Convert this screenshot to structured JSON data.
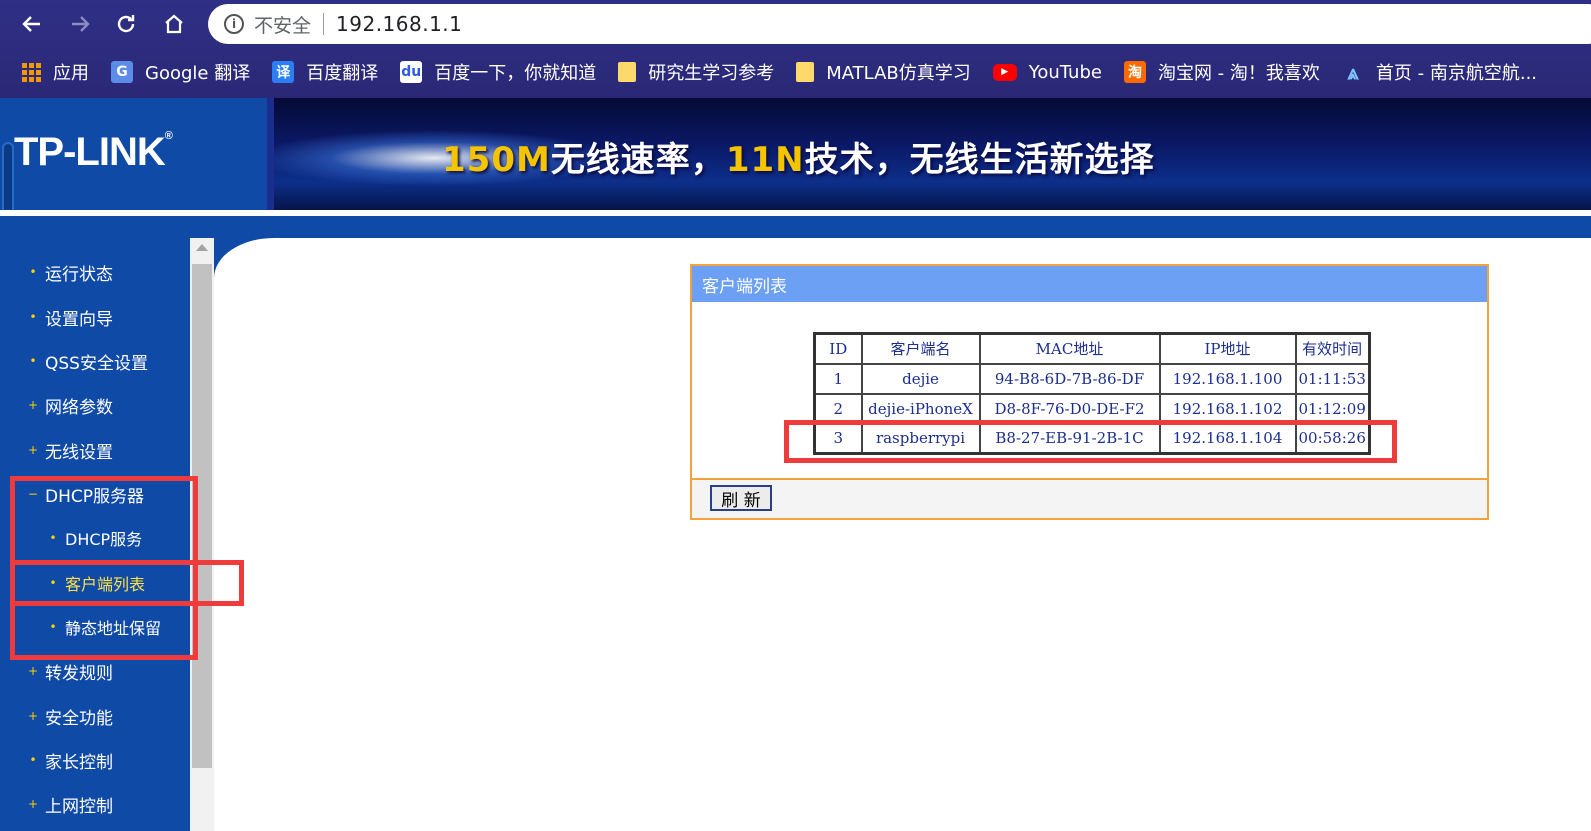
{
  "browser": {
    "omnibox": {
      "security_label": "不安全",
      "url": "192.168.1.1"
    },
    "bookmarks": [
      {
        "label": "应用",
        "icon": "apps-grid-icon"
      },
      {
        "label": "Google 翻译",
        "icon": "google-translate-icon"
      },
      {
        "label": "百度翻译",
        "icon": "baidu-translate-icon"
      },
      {
        "label": "百度一下，你就知道",
        "icon": "baidu-paw-icon"
      },
      {
        "label": "研究生学习参考",
        "icon": "folder-icon"
      },
      {
        "label": "MATLAB仿真学习",
        "icon": "folder-icon"
      },
      {
        "label": "YouTube",
        "icon": "youtube-icon"
      },
      {
        "label": "淘宝网 - 淘！我喜欢",
        "icon": "taobao-icon"
      },
      {
        "label": "首页 - 南京航空航...",
        "icon": "nuaa-icon"
      }
    ]
  },
  "header": {
    "logo": "TP-LINK",
    "slogan_part1": "150M",
    "slogan_part2": "无线速率，",
    "slogan_part3": "11N",
    "slogan_part4": "技术，无线生活新选择"
  },
  "sidebar": {
    "items": [
      {
        "label": "运行状态",
        "marker": "•"
      },
      {
        "label": "设置向导",
        "marker": "•"
      },
      {
        "label": "QSS安全设置",
        "marker": "•"
      },
      {
        "label": "网络参数",
        "marker": "+"
      },
      {
        "label": "无线设置",
        "marker": "+"
      },
      {
        "label": "DHCP服务器",
        "marker": "−"
      },
      {
        "label": "DHCP服务",
        "marker": "•"
      },
      {
        "label": "客户端列表",
        "marker": "•"
      },
      {
        "label": "静态地址保留",
        "marker": "•"
      },
      {
        "label": "转发规则",
        "marker": "+"
      },
      {
        "label": "安全功能",
        "marker": "+"
      },
      {
        "label": "家长控制",
        "marker": "•"
      },
      {
        "label": "上网控制",
        "marker": "+"
      }
    ]
  },
  "client_list": {
    "title": "客户端列表",
    "columns": [
      "ID",
      "客户端名",
      "MAC地址",
      "IP地址",
      "有效时间"
    ],
    "rows": [
      [
        "1",
        "dejie",
        "94-B8-6D-7B-86-DF",
        "192.168.1.100",
        "01:11:53"
      ],
      [
        "2",
        "dejie-iPhoneX",
        "D8-8F-76-D0-DE-F2",
        "192.168.1.102",
        "01:12:09"
      ],
      [
        "3",
        "raspberrypi",
        "B8-27-EB-91-2B-1C",
        "192.168.1.104",
        "00:58:26"
      ]
    ],
    "refresh_label": "刷 新"
  },
  "colors": {
    "highlight": "#ef3b3b",
    "sidebar_bg": "#0f4aa6",
    "panel_border": "#f2a33c",
    "panel_header": "#6ba0f5"
  }
}
